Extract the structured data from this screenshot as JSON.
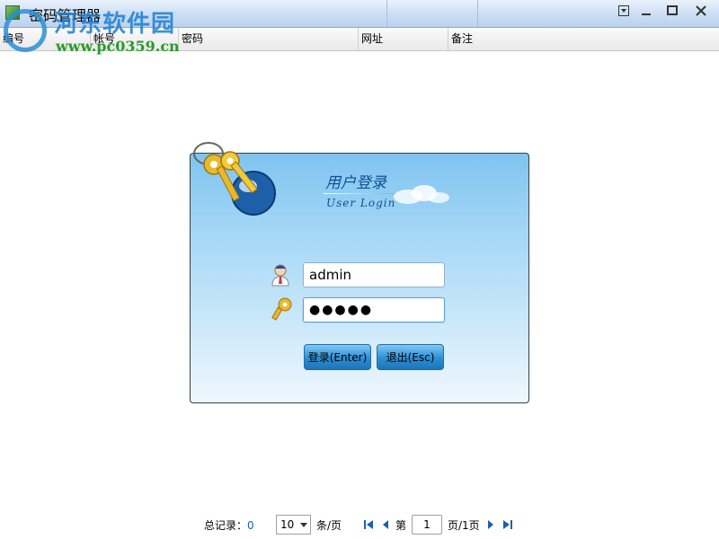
{
  "window": {
    "title": "密码管理器",
    "watermark_name": "河东软件园",
    "watermark_url": "www.pc0359.cn"
  },
  "grid": {
    "columns": [
      "编号",
      "帐号",
      "密码",
      "网址",
      "备注"
    ]
  },
  "login": {
    "title_cn": "用户登录",
    "title_en": "User Login",
    "username": "admin",
    "password_mask": "●●●●●",
    "login_button": "登录(Enter)",
    "exit_button": "退出(Esc)"
  },
  "pager": {
    "total_label": "总记录：",
    "total_value": "0",
    "page_size": "10",
    "per_page_label": "条/页",
    "page_prefix": "第",
    "current_page": "1",
    "page_suffix": "页/1页"
  },
  "icons": {
    "first": "first-page-icon",
    "prev": "prev-page-icon",
    "next": "next-page-icon",
    "last": "last-page-icon"
  },
  "colors": {
    "accent": "#1d74b8",
    "panel_top": "#7fc4f0",
    "count_link": "#1a5fb4"
  }
}
